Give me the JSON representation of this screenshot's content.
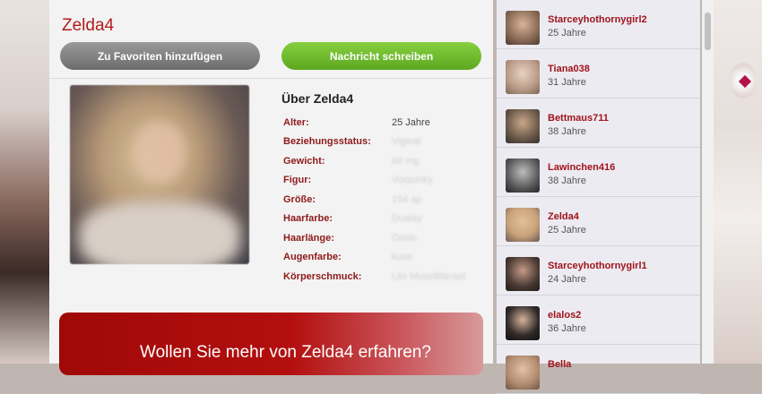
{
  "profile": {
    "title": "Zelda4",
    "favorite_button": "Zu Favoriten hinzufügen",
    "message_button": "Nachricht schreiben",
    "about_title": "Über Zelda4",
    "attributes": [
      {
        "label": "Alter:",
        "value": "25 Jahre",
        "blurred": false
      },
      {
        "label": "Beziehungsstatus:",
        "value": "Vigival",
        "blurred": true
      },
      {
        "label": "Gewicht:",
        "value": "60 mg",
        "blurred": true
      },
      {
        "label": "Figur:",
        "value": "Vorpunky",
        "blurred": true
      },
      {
        "label": "Größe:",
        "value": "154 ap",
        "blurred": true
      },
      {
        "label": "Haarfarbe:",
        "value": "Duaisy",
        "blurred": true
      },
      {
        "label": "Haarlänge:",
        "value": "Ossin",
        "blurred": true
      },
      {
        "label": "Augenfarbe:",
        "value": "kuse",
        "blurred": true
      },
      {
        "label": "Körperschmuck:",
        "value": "Lilo Museltfänsel",
        "blurred": true
      }
    ]
  },
  "banner": {
    "text": "Wollen Sie mehr von Zelda4 erfahren?"
  },
  "sidebar": {
    "items": [
      {
        "name": "Starceyhothornygirl2",
        "age": "25 Jahre",
        "color": "#8a6a55"
      },
      {
        "name": "Tiana038",
        "age": "31 Jahre",
        "color": "#b89a86"
      },
      {
        "name": "Bettmaus711",
        "age": "38 Jahre",
        "color": "#6b5a4a"
      },
      {
        "name": "Lawinchen416",
        "age": "38 Jahre",
        "color": "#5a5a5a"
      },
      {
        "name": "Zelda4",
        "age": "25 Jahre",
        "color": "#c9a27a"
      },
      {
        "name": "Starceyhothornygirl1",
        "age": "24 Jahre",
        "color": "#4a3a34"
      },
      {
        "name": "elalos2",
        "age": "36 Jahre",
        "color": "#2f2a28"
      },
      {
        "name": "Bella",
        "age": "",
        "color": "#b08a6e"
      }
    ]
  }
}
